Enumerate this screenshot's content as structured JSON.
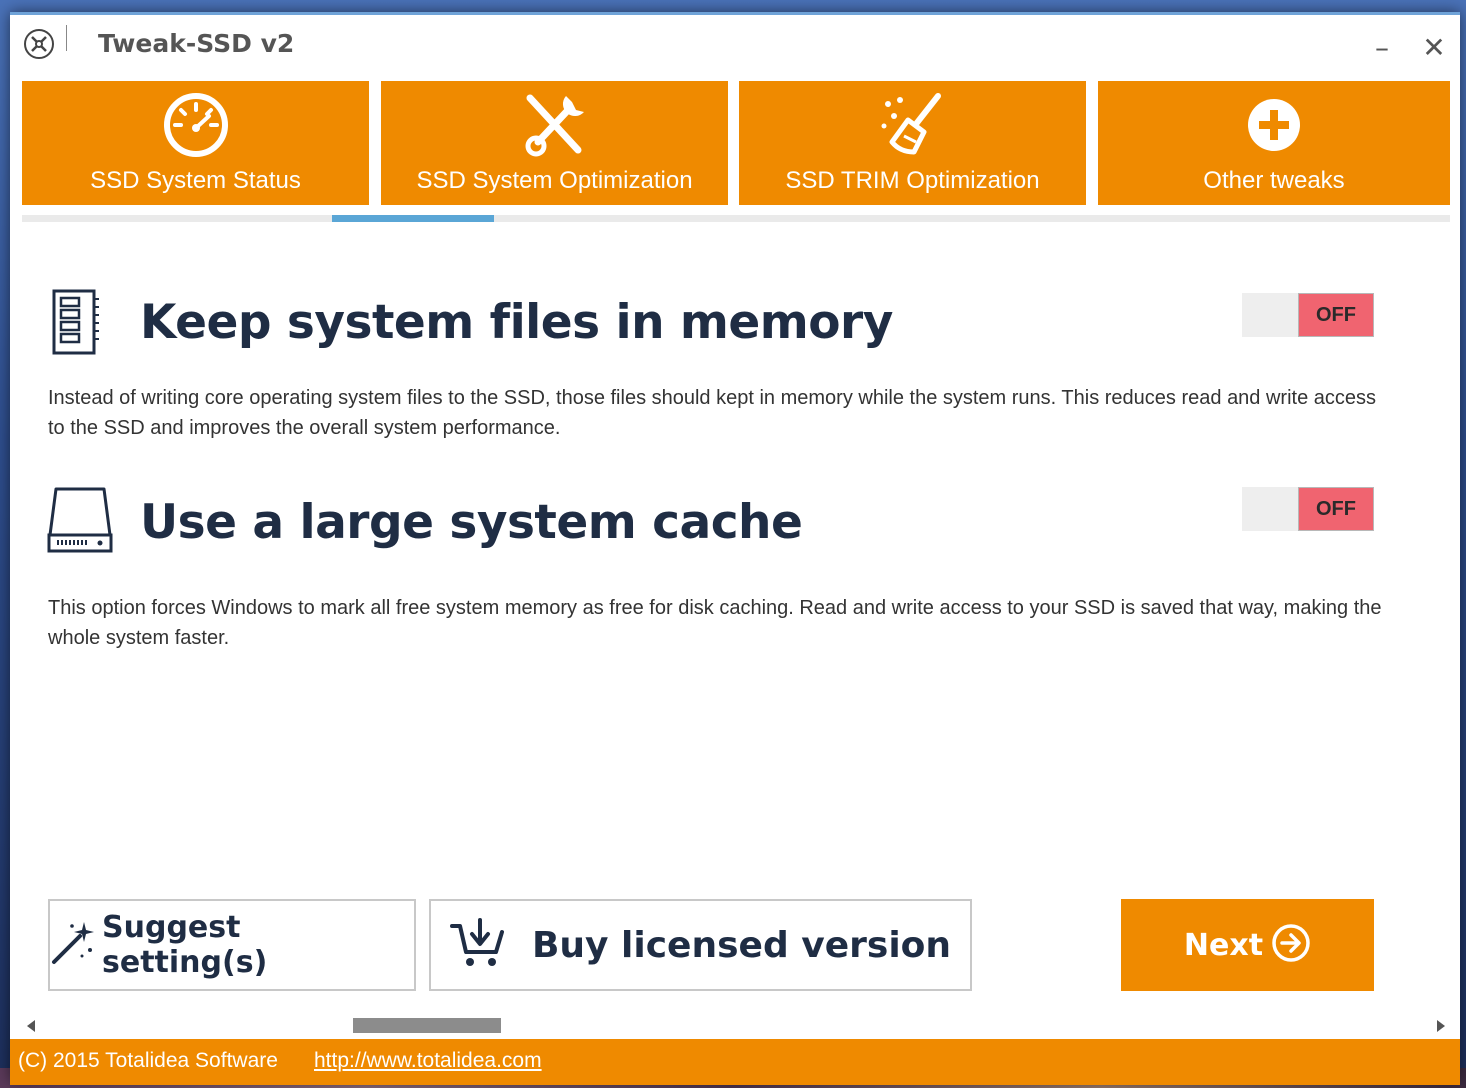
{
  "window": {
    "title": "Tweak-SSD v2",
    "minimize_glyph": "–",
    "close_glyph": "✕"
  },
  "tabs": [
    {
      "label": "SSD System Status",
      "icon": "speedometer-icon"
    },
    {
      "label": "SSD System Optimization",
      "icon": "tools-icon",
      "active": true
    },
    {
      "label": "SSD TRIM Optimization",
      "icon": "broom-icon"
    },
    {
      "label": "Other tweaks",
      "icon": "plus-circle-icon"
    }
  ],
  "settings": [
    {
      "title": "Keep system files in memory",
      "icon": "memory-module-icon",
      "toggle": "OFF",
      "description": "Instead of writing core operating system files to the SSD, those files should kept in memory while the system runs. This reduces read and write access to the SSD and improves the overall system performance."
    },
    {
      "title": "Use a large system cache",
      "icon": "hard-drive-icon",
      "toggle": "OFF",
      "description": "This option forces Windows to mark all free system memory as free for disk caching. Read and write access to your SSD is saved that way, making the whole system faster."
    }
  ],
  "buttons": {
    "suggest": "Suggest setting(s)",
    "buy": "Buy licensed version",
    "next": "Next"
  },
  "footer": {
    "copyright": "(C) 2015 Totalidea Software",
    "link": "http://www.totalidea.com"
  },
  "colors": {
    "accent": "#ef8a00",
    "active_tab_indicator": "#5aa6d6",
    "toggle_off": "#f06470"
  }
}
